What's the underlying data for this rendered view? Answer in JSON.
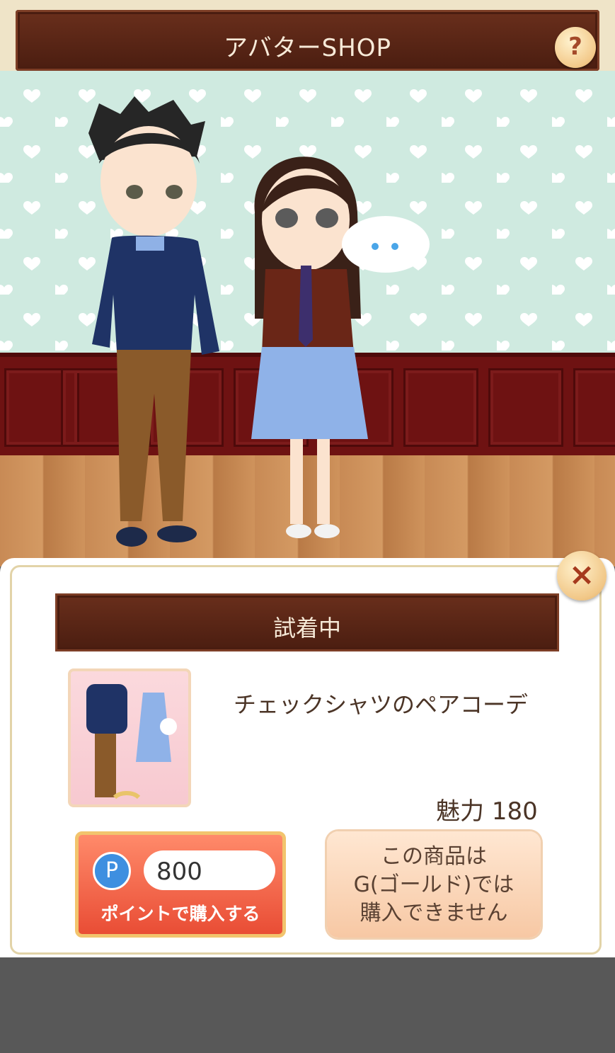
{
  "header": {
    "title": "アバターSHOP",
    "help_icon": "?"
  },
  "preview": {
    "background": "heart wallpaper and wooden floor"
  },
  "modal": {
    "close_icon": "×",
    "status": "試着中",
    "item": {
      "name": "チェックシャツのペアコーデ",
      "charm_label": "魅力",
      "charm_value": "180"
    },
    "buy": {
      "currency_icon": "P",
      "price": "800",
      "label": "ポイントで購入する"
    },
    "gold_notice": "この商品は\nG(ゴールド)では\n購入できません"
  },
  "colors": {
    "header": "#4a1d10",
    "buy_button": "#e94d35",
    "accent_gold": "#f2c46d"
  }
}
